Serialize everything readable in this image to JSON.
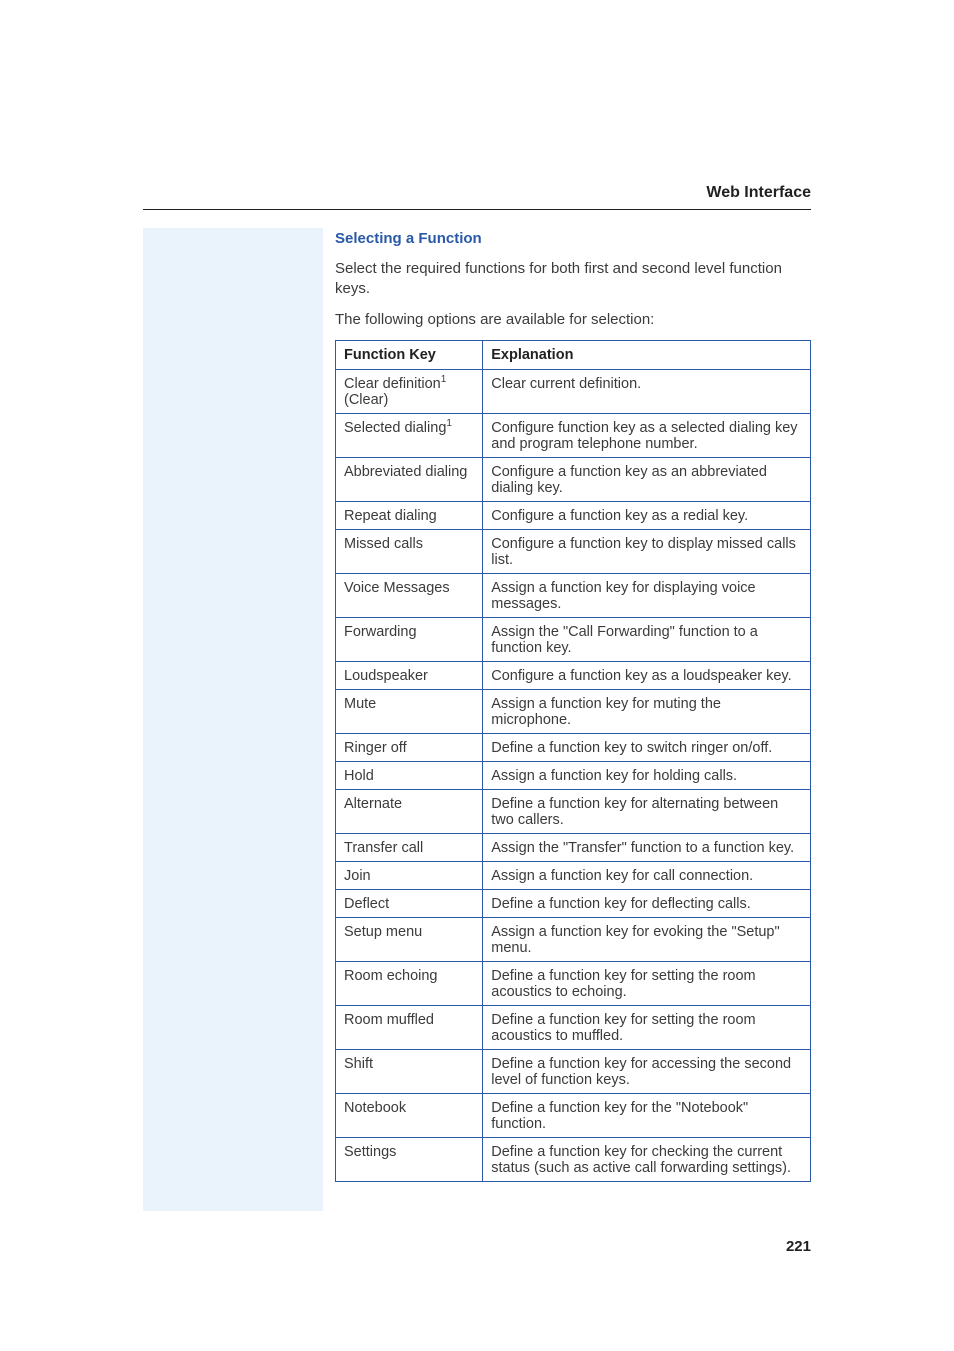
{
  "header": {
    "running_title": "Web Interface"
  },
  "section": {
    "subheading": "Selecting a Function",
    "para1": "Select the required functions for both first and second level function keys.",
    "para2": "The following options are available for selection:"
  },
  "table": {
    "headers": {
      "key": "Function Key",
      "exp": "Explanation"
    },
    "rows": [
      {
        "key": "Clear definition",
        "sup": "1",
        "key_suffix": "(Clear)",
        "exp": "Clear current definition."
      },
      {
        "key": "Selected dialing",
        "sup": "1",
        "key_suffix": "",
        "exp": "Configure function key as a selected dialing key and program telephone number."
      },
      {
        "key": "Abbreviated dialing",
        "sup": "",
        "key_suffix": "",
        "exp": "Configure a function key as an abbreviated dialing key."
      },
      {
        "key": "Repeat dialing",
        "sup": "",
        "key_suffix": "",
        "exp": "Configure a function key as a redial key."
      },
      {
        "key": "Missed calls",
        "sup": "",
        "key_suffix": "",
        "exp": "Configure a function key to display missed calls list."
      },
      {
        "key": "Voice Messages",
        "sup": "",
        "key_suffix": "",
        "exp": "Assign a function key for displaying voice messages."
      },
      {
        "key": "Forwarding",
        "sup": "",
        "key_suffix": "",
        "exp": "Assign the \"Call Forwarding\" function to a function key."
      },
      {
        "key": "Loudspeaker",
        "sup": "",
        "key_suffix": "",
        "exp": "Configure a function key as a loudspeaker key."
      },
      {
        "key": "Mute",
        "sup": "",
        "key_suffix": "",
        "exp": "Assign a function key for muting the microphone."
      },
      {
        "key": "Ringer off",
        "sup": "",
        "key_suffix": "",
        "exp": "Define a function key to switch ringer on/off."
      },
      {
        "key": "Hold",
        "sup": "",
        "key_suffix": "",
        "exp": "Assign a function key for holding calls."
      },
      {
        "key": "Alternate",
        "sup": "",
        "key_suffix": "",
        "exp": "Define a function key for alternating between two callers."
      },
      {
        "key": "Transfer call",
        "sup": "",
        "key_suffix": "",
        "exp": "Assign the \"Transfer\" function to a function key."
      },
      {
        "key": "Join",
        "sup": "",
        "key_suffix": "",
        "exp": "Assign a function key for call connection."
      },
      {
        "key": "Deflect",
        "sup": "",
        "key_suffix": "",
        "exp": "Define a function key for deflecting calls."
      },
      {
        "key": "Setup menu",
        "sup": "",
        "key_suffix": "",
        "exp": "Assign a function key for evoking the \"Setup\" menu."
      },
      {
        "key": "Room echoing",
        "sup": "",
        "key_suffix": "",
        "exp": "Define a function key for setting the room acoustics to echoing."
      },
      {
        "key": "Room muffled",
        "sup": "",
        "key_suffix": "",
        "exp": "Define a function key for setting the room acoustics to muffled."
      },
      {
        "key": "Shift",
        "sup": "",
        "key_suffix": "",
        "exp": "Define a function key for accessing the second level of function keys."
      },
      {
        "key": "Notebook",
        "sup": "",
        "key_suffix": "",
        "exp": "Define a function key for the \"Notebook\" function."
      },
      {
        "key": "Settings",
        "sup": "",
        "key_suffix": "",
        "exp": "Define a function key for checking the current status (such as active call forwarding settings)."
      }
    ]
  },
  "page_number": "221"
}
